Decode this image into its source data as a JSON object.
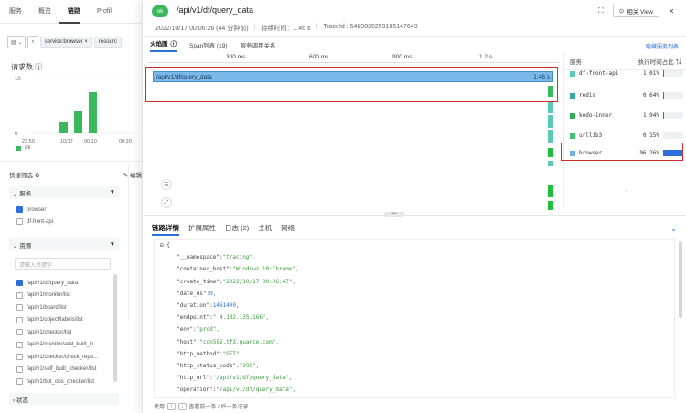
{
  "bg": {
    "nav_tabs": [
      "服务",
      "概览",
      "链路",
      "Profil"
    ],
    "filter_chips": [
      "service:browser",
      "resourc"
    ],
    "chart_title": "请求数",
    "legend_label": "ok",
    "quick_filter": "快捷筛选",
    "edit_label": "编辑",
    "service_section": "服务",
    "services": [
      {
        "label": "browser",
        "checked": true
      },
      {
        "label": "df-front-api",
        "checked": false
      }
    ],
    "resource_section": "资源",
    "resource_search_placeholder": "请输入关键字",
    "resources": [
      {
        "label": "/api/v1/df/query_data",
        "checked": true
      },
      {
        "label": "/api/v1/monitor/list",
        "checked": false
      },
      {
        "label": "/api/v1/board/list",
        "checked": false
      },
      {
        "label": "/api/v1/object/labels/list",
        "checked": false
      },
      {
        "label": "/api/v1/checker/list",
        "checked": false
      },
      {
        "label": "/api/v1/monitor/add_built_in",
        "checked": false
      },
      {
        "label": "/api/v1/checker/check_repe...",
        "checked": false
      },
      {
        "label": "/api/v1/self_built_checker/list",
        "checked": false
      },
      {
        "label": "/api/v1/bot_obs_checker/list",
        "checked": false
      }
    ],
    "status_section": "状态"
  },
  "chart_data": {
    "type": "bar",
    "title": "请求数",
    "x_ticks": [
      "23:50",
      "10/17",
      "00:10",
      "00:20"
    ],
    "y_ticks": [
      10,
      0
    ],
    "bars": [
      {
        "x": "10/17-a",
        "value": 2
      },
      {
        "x": "10/17-b",
        "value": 4
      },
      {
        "x": "10/17-c",
        "value": 7.5
      }
    ],
    "series": [
      {
        "name": "ok",
        "color": "#3ab85c"
      }
    ],
    "ylim": [
      0,
      10
    ]
  },
  "drawer": {
    "status": "ok",
    "title": "/api/v1/df/query_data",
    "datetime": "2022/10/17 00:06:26 (44 分钟前)",
    "duration": "持续时间：1.46 s",
    "trace_id": "TraceId : 5469835259185147643",
    "related_view": "相关 View",
    "tabs": [
      "火焰图",
      "Span列表 (19)",
      "服务调用关系"
    ],
    "hide_link": "隐藏服务列表",
    "ruler_ticks": [
      "300 ms",
      "600 ms",
      "900 ms",
      "1.2 s"
    ],
    "root_span": {
      "label": "/api/v1/df/query_data",
      "duration": "1.46 s"
    },
    "service_head": {
      "name": "服务",
      "ratio": "执行时间占比"
    },
    "services": [
      {
        "name": "df-front-api",
        "pct": "1.01%",
        "value": 1.01,
        "color": "#5bc9b8"
      },
      {
        "name": "redis",
        "pct": "0.64%",
        "value": 0.64,
        "color": "#3aa6a0"
      },
      {
        "name": "kodo-inner",
        "pct": "1.94%",
        "value": 1.94,
        "color": "#2fae5a"
      },
      {
        "name": "urllib3",
        "pct": "0.15%",
        "value": 0.15,
        "color": "#3fc46a"
      },
      {
        "name": "browser",
        "pct": "96.26%",
        "value": 96.26,
        "color": "#6fb0e8"
      }
    ],
    "detail_tabs": [
      "链路详情",
      "扩展属性",
      "日志 (2)",
      "主机",
      "网络"
    ],
    "json_lines": [
      {
        "k": "",
        "v": "{",
        "t": "k",
        "ind": 0
      },
      {
        "k": "\"__namespace\":",
        "v": "\"tracing\",",
        "t": "s",
        "ind": 1
      },
      {
        "k": "\"container_host\":",
        "v": "\"Windows 10:Chrome\",",
        "t": "s",
        "ind": 1
      },
      {
        "k": "\"create_time\":",
        "v": "\"2022/10/17 00:06:47\",",
        "t": "s",
        "ind": 1
      },
      {
        "k": "\"date_ns\":",
        "v": "0,",
        "t": "n",
        "ind": 1
      },
      {
        "k": "\"duration\":",
        "v": "1461400,",
        "t": "n",
        "ind": 1
      },
      {
        "k": "\"endpoint\":",
        "v": "\"  4.132.135.166\",",
        "t": "s",
        "ind": 1
      },
      {
        "k": "\"env\":",
        "v": "\"prod\",",
        "t": "s",
        "ind": 1
      },
      {
        "k": "\"host\":",
        "v": "\"cdn552.tf3.guance.com\",",
        "t": "s",
        "ind": 1
      },
      {
        "k": "\"http_method\":",
        "v": "\"GET\",",
        "t": "s",
        "ind": 1
      },
      {
        "k": "\"http_status_code\":",
        "v": "\"200\",",
        "t": "s",
        "ind": 1
      },
      {
        "k": "\"http_url\":",
        "v": "\"/api/v1/df/query_data\",",
        "t": "s",
        "ind": 1
      },
      {
        "k": "\"operation\":",
        "v": "\"/api/v1/df/query_data\",",
        "t": "s",
        "ind": 1
      }
    ],
    "footer": {
      "prefix": "使用",
      "up": "↑",
      "down": "↓",
      "suffix": "查看前一条 / 后一条记录"
    }
  }
}
